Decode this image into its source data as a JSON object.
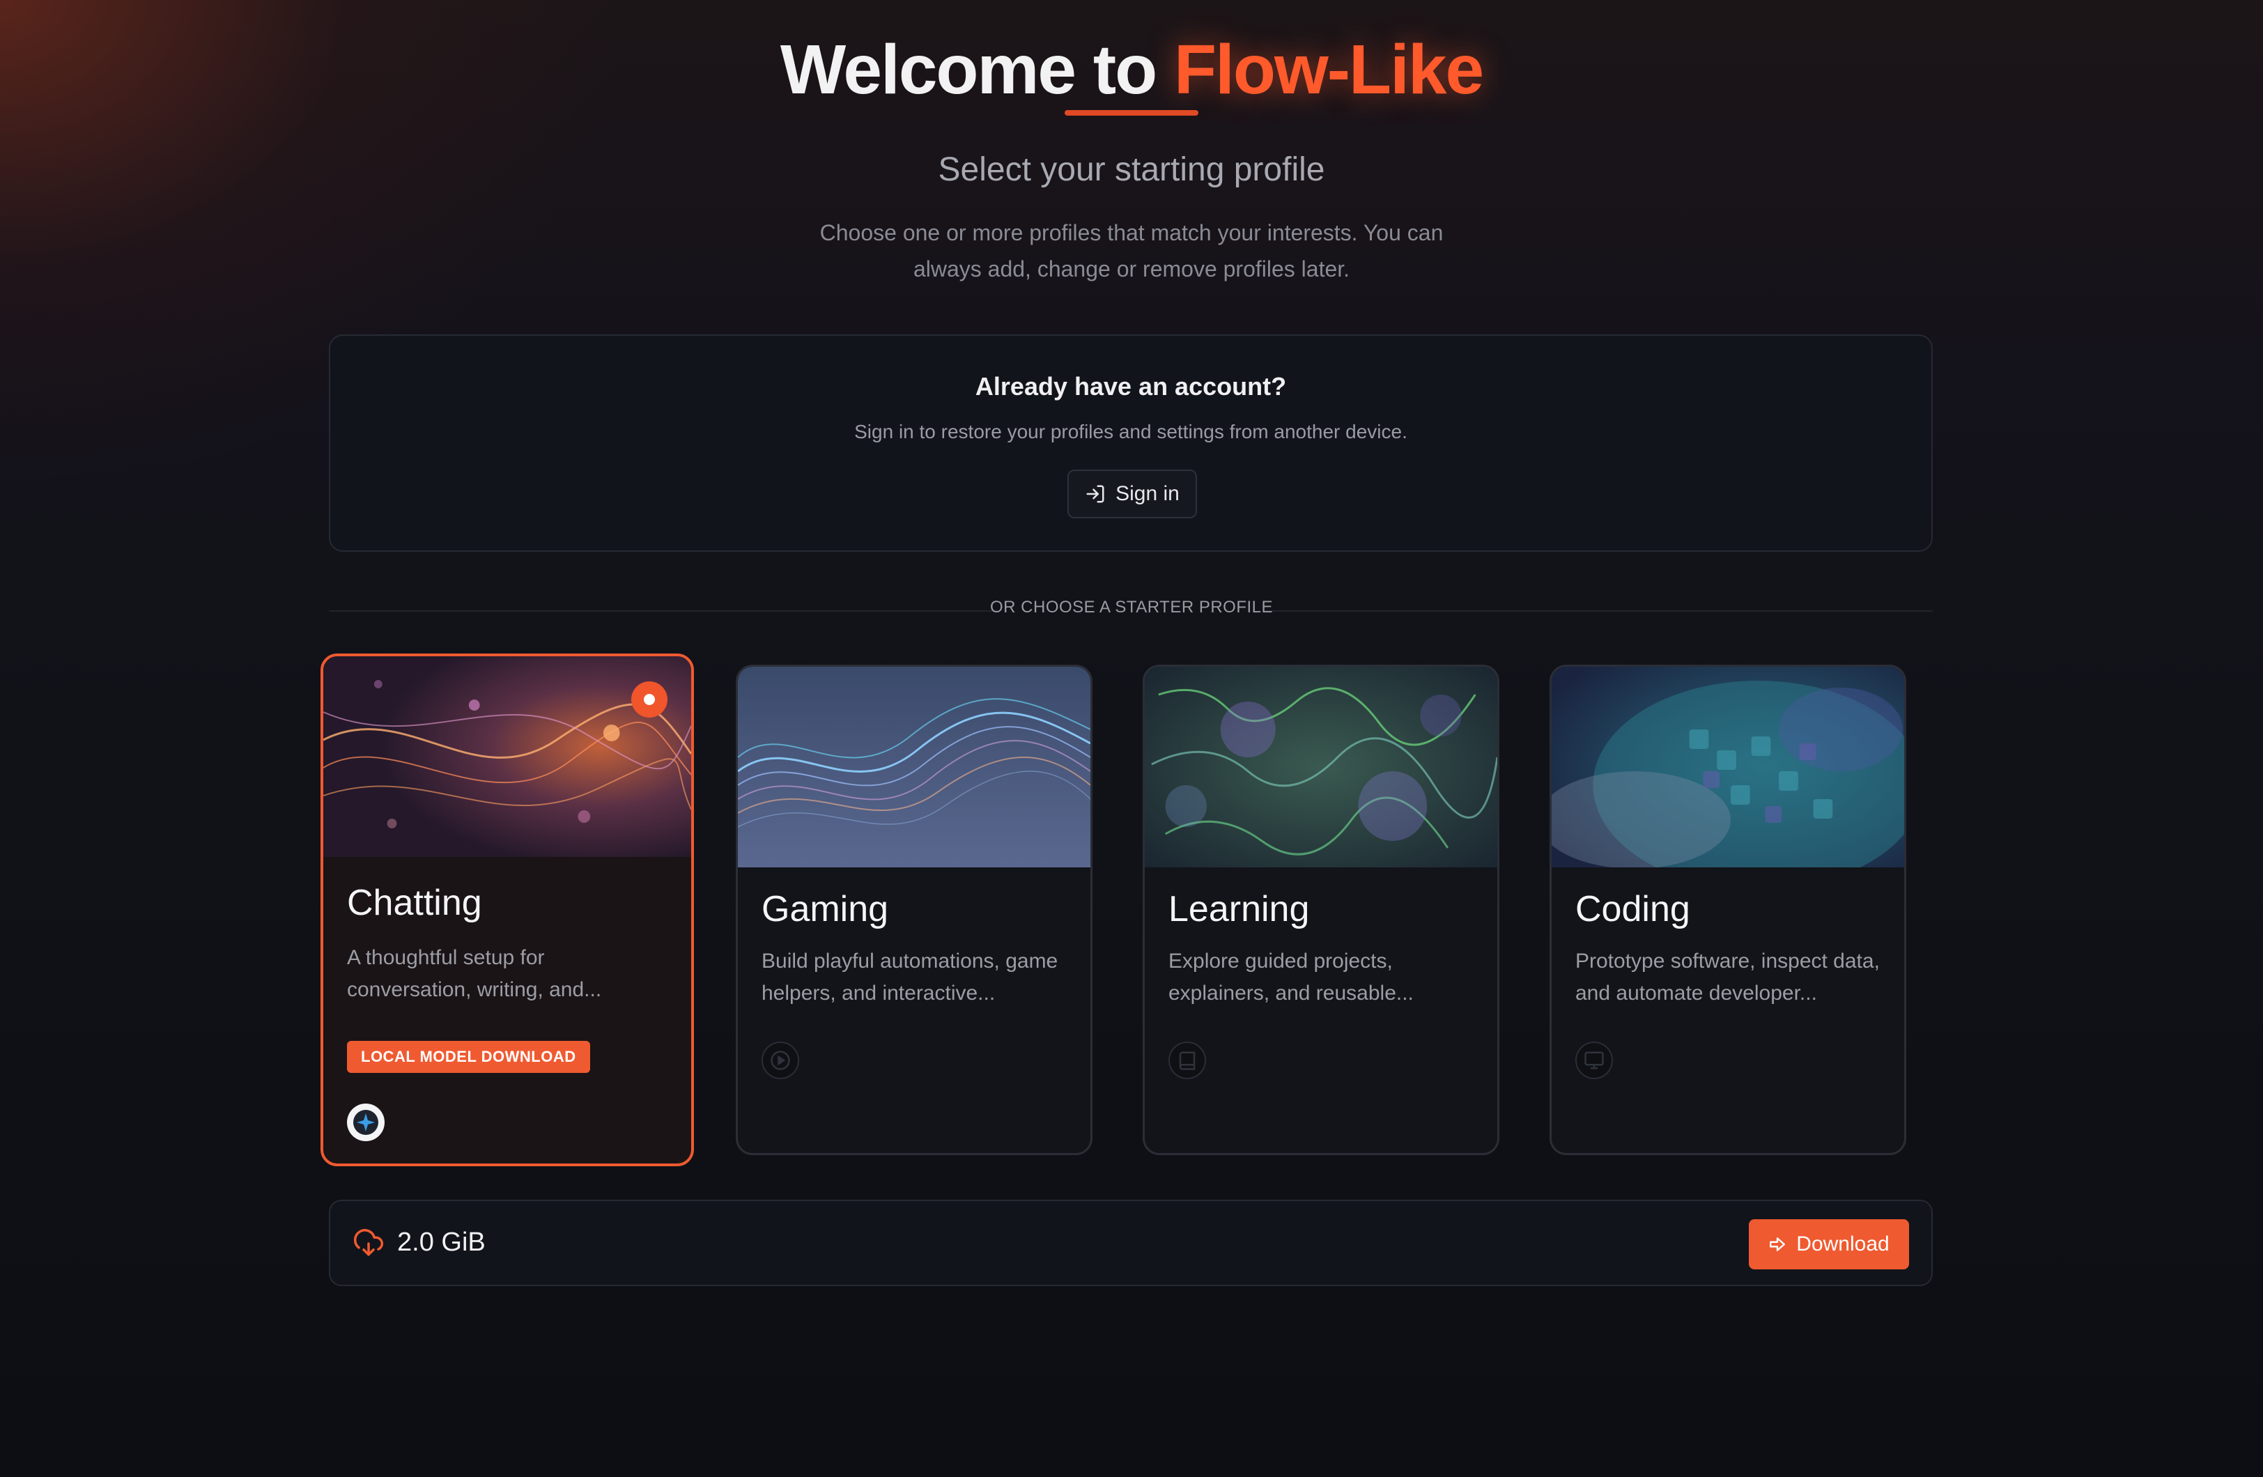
{
  "header": {
    "title_prefix": "Welcome to",
    "title_brand": "Flow-Like",
    "subtitle": "Select your starting profile",
    "intro": "Choose one or more profiles that match your interests. You can always add, change or remove profiles later."
  },
  "account": {
    "title": "Already have an account?",
    "description": "Sign in to restore your profiles and settings from another device.",
    "signin_label": "Sign in",
    "signin_icon": "log-in-icon"
  },
  "divider": {
    "label": "OR CHOOSE A STARTER PROFILE"
  },
  "profiles": [
    {
      "title": "Chatting",
      "description": "A thoughtful setup for conversation, writing, and...",
      "badge": "LOCAL MODEL DOWNLOAD",
      "selected": true,
      "icon": "sparkle-icon"
    },
    {
      "title": "Gaming",
      "description": "Build playful automations, game helpers, and interactive...",
      "selected": false,
      "icon": "play-icon"
    },
    {
      "title": "Learning",
      "description": "Explore guided projects, explainers, and reusable...",
      "selected": false,
      "icon": "book-icon"
    },
    {
      "title": "Coding",
      "description": "Prototype software, inspect data, and automate developer...",
      "selected": false,
      "icon": "monitor-icon"
    }
  ],
  "download": {
    "size": "2.0 GiB",
    "button_label": "Download",
    "icon": "cloud-download-icon",
    "button_icon": "arrow-right-icon"
  },
  "colors": {
    "accent": "#ef5a30",
    "background": "#0e1016",
    "card": "#121419"
  }
}
